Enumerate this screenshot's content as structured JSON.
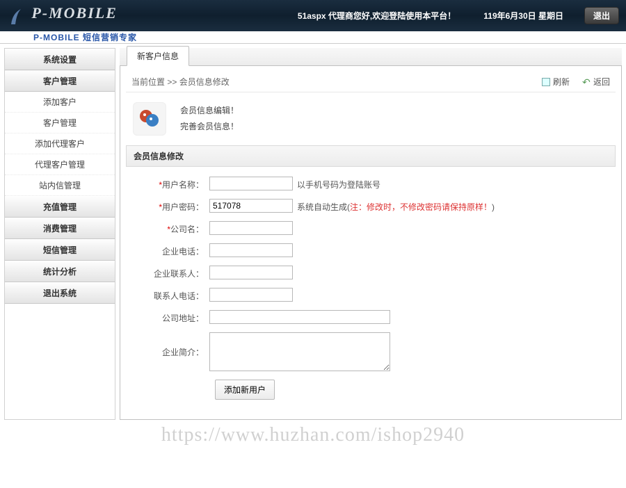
{
  "header": {
    "logo": "P-MOBILE",
    "subtitle": "P-MOBILE 短信营销专家",
    "welcome": "51aspx 代理商您好,欢迎登陆使用本平台！",
    "date": "119年6月30日 星期日",
    "logout": "退出"
  },
  "sidebar": {
    "cats": [
      {
        "label": "系统设置",
        "subs": []
      },
      {
        "label": "客户管理",
        "subs": [
          "添加客户",
          "客户管理",
          "添加代理客户",
          "代理客户管理",
          "站内信管理"
        ]
      },
      {
        "label": "充值管理",
        "subs": []
      },
      {
        "label": "消费管理",
        "subs": []
      },
      {
        "label": "短信管理",
        "subs": []
      },
      {
        "label": "统计分析",
        "subs": []
      },
      {
        "label": "退出系统",
        "subs": []
      }
    ]
  },
  "main": {
    "tab": "新客户信息",
    "breadcrumb_label": "当前位置",
    "breadcrumb_sep": " >> ",
    "breadcrumb_page": "会员信息修改",
    "action_refresh": "刷新",
    "action_back": "返回",
    "info_line1": "会员信息编辑！",
    "info_line2": "完善会员信息！",
    "section_title": "会员信息修改",
    "form": {
      "username_label": "用户名称：",
      "username_value": "",
      "username_hint": "以手机号码为登陆账号",
      "password_label": "用户密码：",
      "password_value": "517078",
      "password_hint_a": "系统自动生成(",
      "password_hint_b": "注：修改时，不修改密码请保持原样！",
      "password_hint_c": ")",
      "company_label": "公司名：",
      "company_value": "",
      "phone_label": "企业电话：",
      "phone_value": "",
      "contact_label": "企业联系人：",
      "contact_value": "",
      "contact_phone_label": "联系人电话：",
      "contact_phone_value": "",
      "address_label": "公司地址：",
      "address_value": "",
      "intro_label": "企业简介：",
      "intro_value": "",
      "submit": "添加新用户"
    }
  },
  "watermark": "https://www.huzhan.com/ishop2940"
}
